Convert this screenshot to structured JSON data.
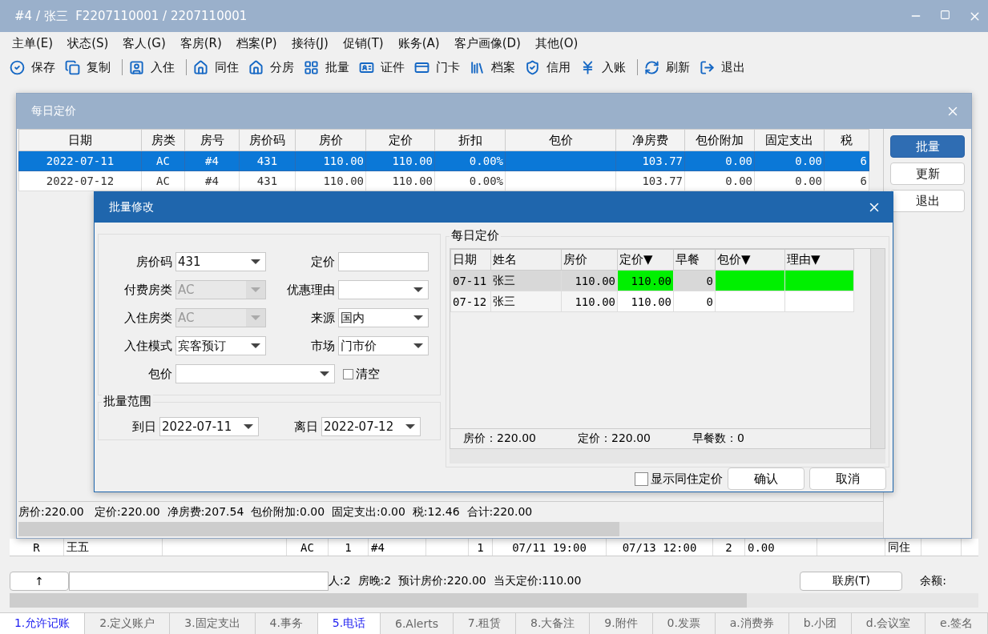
{
  "window": {
    "title": "#4 / 张三  F2207110001 / 2207110001"
  },
  "menu": [
    "主单(E)",
    "状态(S)",
    "客人(G)",
    "客房(R)",
    "档案(P)",
    "接待(J)",
    "促销(T)",
    "账务(A)",
    "客户画像(D)",
    "其他(O)"
  ],
  "toolbar": [
    {
      "kind": "button",
      "label": "保存"
    },
    {
      "kind": "button",
      "label": "复制"
    },
    {
      "kind": "separator"
    },
    {
      "kind": "button",
      "label": "入住"
    },
    {
      "kind": "separator"
    },
    {
      "kind": "button",
      "label": "同住"
    },
    {
      "kind": "button",
      "label": "分房"
    },
    {
      "kind": "button",
      "label": "批量"
    },
    {
      "kind": "button",
      "label": "证件"
    },
    {
      "kind": "button",
      "label": "门卡"
    },
    {
      "kind": "button",
      "label": "档案"
    },
    {
      "kind": "button",
      "label": "信用"
    },
    {
      "kind": "button",
      "label": "入账"
    },
    {
      "kind": "separator"
    },
    {
      "kind": "button",
      "label": "刷新"
    },
    {
      "kind": "button",
      "label": "退出"
    }
  ],
  "guest_row": [
    "R",
    "王五",
    "AC",
    "1",
    "#4",
    "1",
    "07/11 19:00",
    "07/13 12:00",
    "2",
    "0.00",
    "同住"
  ],
  "info_bar": {
    "up_button": "↑",
    "summary": "人:2  房晚:2  预计房价:220.00  当天定价:110.00",
    "link_button": "联房(T)",
    "balance_label": "余额:"
  },
  "bottom_tabs": [
    {
      "label": "1.允许记账",
      "highlighted": true
    },
    {
      "label": "2.定义账户",
      "highlighted": false
    },
    {
      "label": "3.固定支出",
      "highlighted": false
    },
    {
      "label": "4.事务",
      "highlighted": false
    },
    {
      "label": "5.电话",
      "highlighted": true
    },
    {
      "label": "6.Alerts",
      "highlighted": false
    },
    {
      "label": "7.租赁",
      "highlighted": false
    },
    {
      "label": "8.大备注",
      "highlighted": false
    },
    {
      "label": "9.附件",
      "highlighted": false
    },
    {
      "label": "0.发票",
      "highlighted": false
    },
    {
      "label": "a.消费券",
      "highlighted": false
    },
    {
      "label": "b.小团",
      "highlighted": false
    },
    {
      "label": "d.会议室",
      "highlighted": false
    },
    {
      "label": "e.签名",
      "highlighted": false
    }
  ],
  "daily_price_dialog": {
    "title": "每日定价",
    "columns": [
      "日期",
      "房类",
      "房号",
      "房价码",
      "房价",
      "定价",
      "折扣",
      "包价",
      "净房费",
      "包价附加",
      "固定支出",
      "税"
    ],
    "rows": [
      {
        "selected": true,
        "cells": [
          "2022-07-11",
          "AC",
          "#4",
          "431",
          "110.00",
          "110.00",
          "0.00%",
          "",
          "103.77",
          "0.00",
          "0.00",
          "6"
        ]
      },
      {
        "selected": false,
        "cells": [
          "2022-07-12",
          "AC",
          "#4",
          "431",
          "110.00",
          "110.00",
          "0.00%",
          "",
          "103.77",
          "0.00",
          "0.00",
          "6"
        ]
      }
    ],
    "side_buttons": [
      {
        "label": "批量",
        "selected": true
      },
      {
        "label": "更新",
        "selected": false
      },
      {
        "label": "退出",
        "selected": false
      }
    ],
    "summary": "房价:220.00   定价:220.00  净房费:207.54  包价附加:0.00  固定支出:0.00  税:12.46  合计:220.00"
  },
  "batch_dialog": {
    "title": "批量修改",
    "fields": [
      {
        "label": "房价码",
        "kind": "combo",
        "value": "431",
        "disabled": false
      },
      {
        "label": "定价",
        "kind": "text",
        "disabled": false
      },
      {
        "label": "付费房类",
        "kind": "combo",
        "value": "AC",
        "disabled": true
      },
      {
        "label": "优惠理由",
        "kind": "combo",
        "disabled": false
      },
      {
        "label": "入住房类",
        "kind": "combo",
        "value": "AC",
        "disabled": true
      },
      {
        "label": "来源",
        "kind": "combo",
        "value": "国内",
        "disabled": false
      },
      {
        "label": "入住模式",
        "kind": "combo",
        "value": "宾客预订",
        "disabled": false
      },
      {
        "label": "市场",
        "kind": "combo",
        "value": "门市价",
        "disabled": false
      }
    ],
    "package_field": {
      "label": "包价",
      "kind": "combo",
      "disabled": false
    },
    "clear_checkbox": {
      "label": "清空",
      "checked": false
    },
    "range_group": {
      "title": "批量范围",
      "fields": [
        {
          "label": "到日",
          "value": "2022-07-11"
        },
        {
          "label": "离日",
          "value": "2022-07-12"
        }
      ]
    },
    "daily_group": {
      "title": "每日定价",
      "columns": [
        {
          "label": "日期",
          "editable": false
        },
        {
          "label": "姓名",
          "editable": false
        },
        {
          "label": "房价",
          "editable": false
        },
        {
          "label": "定价▼",
          "editable": true
        },
        {
          "label": "早餐",
          "editable": false
        },
        {
          "label": "包价▼",
          "editable": true
        },
        {
          "label": "理由▼",
          "editable": true
        }
      ],
      "rows": [
        {
          "selected": true,
          "cells": [
            "07-11",
            "张三",
            "110.00",
            "110.00",
            "0",
            "",
            ""
          ]
        },
        {
          "selected": false,
          "cells": [
            "07-12",
            "张三",
            "110.00",
            "110.00",
            "0",
            "",
            ""
          ]
        }
      ],
      "summary": [
        "房价：220.00",
        "定价：220.00",
        "早餐数：0"
      ]
    },
    "show_cohabit": {
      "label": "显示同住定价",
      "checked": false
    },
    "buttons": [
      "确认",
      "取消"
    ]
  }
}
